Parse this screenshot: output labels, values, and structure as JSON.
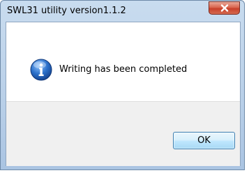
{
  "window": {
    "title": "SWL31 utility version1.1.2",
    "close_icon": "close-icon"
  },
  "dialog": {
    "icon": "info-icon",
    "message": "Writing has been completed"
  },
  "buttons": {
    "ok_label": "OK"
  },
  "colors": {
    "titlebar": "#b8cfe8",
    "close_button": "#c8402a",
    "ok_border": "#3c7fb1",
    "info_icon": "#2a6fc9"
  }
}
